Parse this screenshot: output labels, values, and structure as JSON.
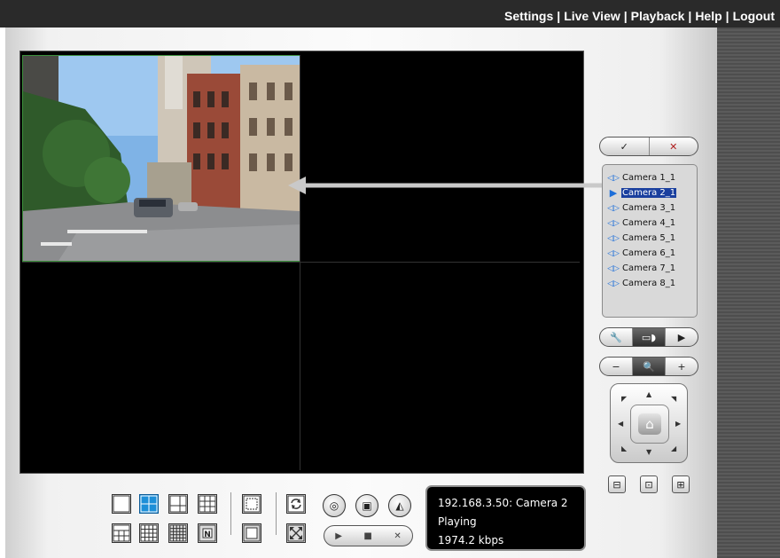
{
  "header": {
    "brand_text": "",
    "nav": [
      {
        "label": "Settings"
      },
      {
        "label": "Live View"
      },
      {
        "label": "Playback"
      },
      {
        "label": "Help"
      },
      {
        "label": "Logout"
      }
    ],
    "separator": "|"
  },
  "cameras": [
    {
      "label": "Camera 1_1",
      "icon": "camera-signal-icon"
    },
    {
      "label": "Camera 2_1",
      "icon": "play-arrow-icon",
      "selected": true
    },
    {
      "label": "Camera 3_1",
      "icon": "camera-signal-icon"
    },
    {
      "label": "Camera 4_1",
      "icon": "camera-signal-icon"
    },
    {
      "label": "Camera 5_1",
      "icon": "camera-signal-icon"
    },
    {
      "label": "Camera 6_1",
      "icon": "camera-signal-icon"
    },
    {
      "label": "Camera 7_1",
      "icon": "camera-signal-icon"
    },
    {
      "label": "Camera 8_1",
      "icon": "camera-signal-icon"
    }
  ],
  "zoom": {
    "minus": "−",
    "plus": "+"
  },
  "status": {
    "line1": "192.168.3.50: Camera 2",
    "line2": "Playing",
    "line3": "1974.2 kbps"
  },
  "colors": {
    "topbar": "#2a2a2a",
    "selected_camera": "#1a3f9e",
    "active_layout": "#1d8fd8",
    "video_border_selected": "#3b8f3b"
  }
}
